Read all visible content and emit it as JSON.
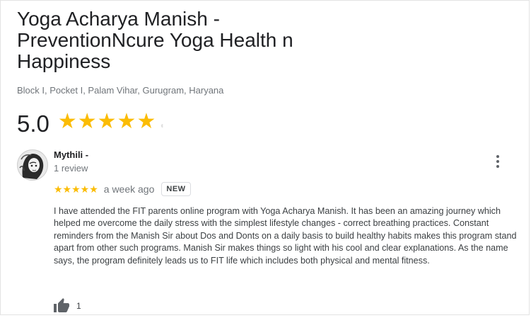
{
  "business": {
    "title": "Yoga Acharya Manish - PreventionNcure Yoga Health n Happiness",
    "address": "Block I, Pocket I, Palam Vihar, Gurugram, Haryana",
    "rating": "5.0",
    "rating_stars": "★★★★★"
  },
  "review": {
    "reviewer_name": "Mythili -",
    "reviewer_count": "1 review",
    "stars": "★★★★★",
    "time": "a week ago",
    "badge": "NEW",
    "text": "I have attended the FIT parents online program with Yoga Acharya Manish. It has been an amazing journey which helped me overcome the daily stress with the simplest lifestyle changes - correct breathing practices. Constant reminders from the Manish Sir about Dos and Donts on a daily basis to build healthy habits makes this program stand apart from other such programs. Manish Sir makes things so light with his cool and clear explanations. As the name says, the program definitely leads us to FIT life which includes both physical and mental fitness.",
    "likes": "1"
  },
  "colors": {
    "star": "#fbbc04",
    "secondary_text": "#70757a",
    "primary_text": "#202124"
  },
  "icons": {
    "menu": "more-vert-icon",
    "like": "thumbs-up-icon",
    "avatar": "reviewer-avatar"
  }
}
